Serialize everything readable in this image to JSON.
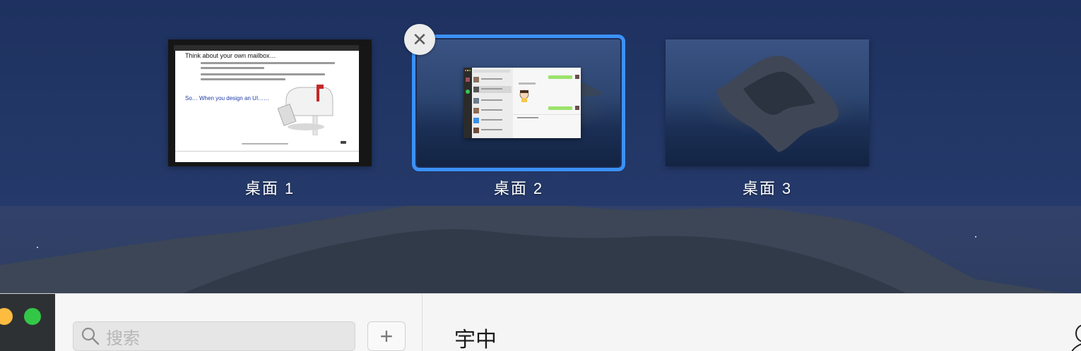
{
  "spaces": [
    {
      "label": "桌面 1",
      "selected": false,
      "content": {
        "slide_heading": "Think about your own mailbox…",
        "slide_callout": "So… When you design an UI……"
      }
    },
    {
      "label": "桌面 2",
      "selected": true
    },
    {
      "label": "桌面 3",
      "selected": false
    }
  ],
  "close_button_symbol": "✕",
  "app_window": {
    "search": {
      "placeholder": "搜索"
    },
    "add_button_symbol": "+",
    "chat_title": "宇中",
    "traffic_lights": {
      "minimize_color": "#fdbc40",
      "maximize_color": "#33c748"
    }
  },
  "colors": {
    "selection_outline": "#3b91f7",
    "chat_bubble": "#9be36b"
  },
  "icons": [
    "close-icon",
    "search-icon",
    "plus-icon",
    "person-icon"
  ]
}
